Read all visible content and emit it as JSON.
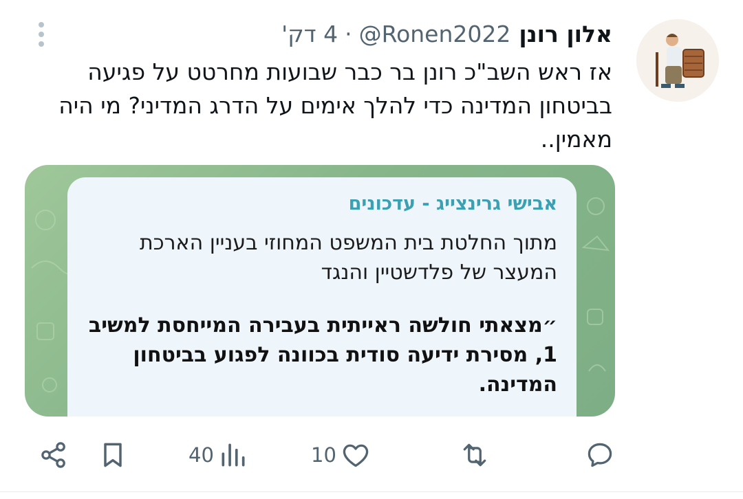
{
  "tweet": {
    "display_name": "אלון רונן",
    "handle": "@Ronen2022",
    "separator": "·",
    "time": "4 דק'",
    "text": "אז ראש השב\"כ רונן בר כבר שבועות מחרטט על פגיעה בביטחון המדינה כדי להלך אימים על הדרג המדיני? מי היה מאמין..",
    "avatar_icon": "avatar-image",
    "more_icon": "more-options-icon"
  },
  "media": {
    "author": "אבישי גרינצייג - עדכונים",
    "paragraph": "מתוך החלטת בית המשפט המחוזי בעניין הארכת המעצר של פלדשטיין והנגד",
    "quote": "״מצאתי חולשה ראייתית בעבירה המייחסת למשיב 1, מסירת ידיעה סודית בכוונה לפגוע בביטחון המדינה."
  },
  "actions": {
    "reply": {
      "icon": "reply-icon",
      "count": ""
    },
    "retweet": {
      "icon": "retweet-icon",
      "count": ""
    },
    "like": {
      "icon": "heart-icon",
      "count": "10"
    },
    "views": {
      "icon": "views-icon",
      "count": "40"
    },
    "bookmark": {
      "icon": "bookmark-icon",
      "count": ""
    },
    "share": {
      "icon": "share-icon",
      "count": ""
    }
  },
  "colors": {
    "text_primary": "#0f1419",
    "text_secondary": "#536471",
    "media_author": "#3aa0b2",
    "media_bubble": "#eef6fb",
    "media_background": "#8ab88c"
  }
}
